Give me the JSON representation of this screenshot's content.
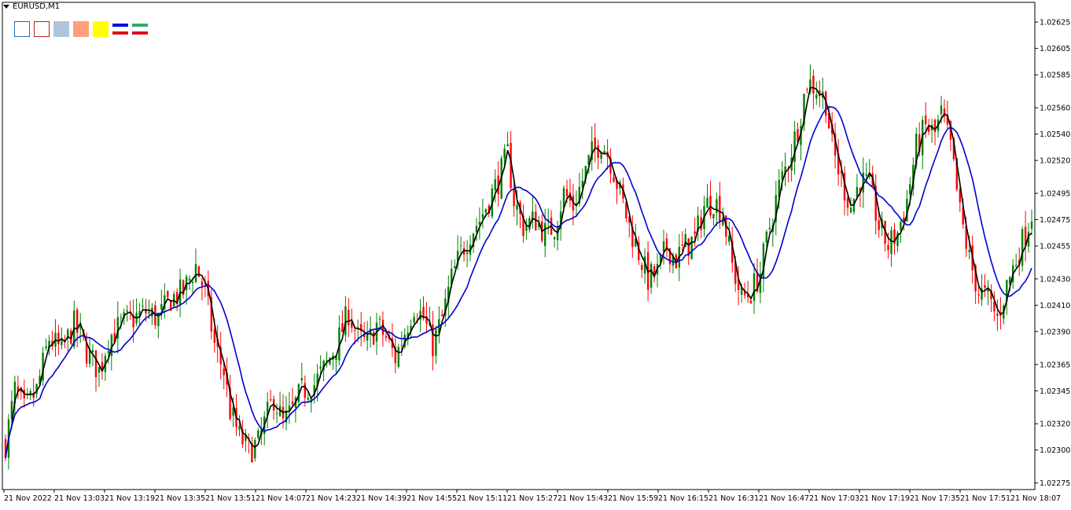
{
  "header": {
    "symbol_label": "EURUSD,M1"
  },
  "toolbar": {
    "buttons": [
      {
        "name": "bull-candle-outline-swatch",
        "fill": "#ffffff",
        "border": "#2d6fb3"
      },
      {
        "name": "bear-candle-outline-swatch",
        "fill": "#ffffff",
        "border": "#b22222"
      },
      {
        "name": "bull-body-color-swatch",
        "fill": "#b0c4de",
        "border": "#b0c4de"
      },
      {
        "name": "bear-body-color-swatch",
        "fill": "#ffa07a",
        "border": "#ffa07a"
      },
      {
        "name": "highlight-color-swatch",
        "fill": "#ffff00",
        "border": "#ffff00"
      },
      {
        "name": "line-style-button-1",
        "top": "#0000e0",
        "bottom": "#e01020"
      },
      {
        "name": "line-style-button-2",
        "top": "#33aa66",
        "bottom": "#e01020"
      }
    ]
  },
  "colors": {
    "bull": "#008000",
    "bear": "#ff0000",
    "ma_fast": "#000000",
    "ma_slow": "#0000cc",
    "axis": "#000000"
  },
  "chart_data": {
    "type": "candlestick",
    "symbol": "EURUSD",
    "timeframe": "M1",
    "ylim": [
      1.0227,
      1.0264
    ],
    "y_ticks": [
      "1.02625",
      "1.02605",
      "1.02585",
      "1.02560",
      "1.02540",
      "1.02520",
      "1.02495",
      "1.02475",
      "1.02455",
      "1.02430",
      "1.02410",
      "1.02390",
      "1.02365",
      "1.02345",
      "1.02320",
      "1.02300",
      "1.02275"
    ],
    "x_ticks": [
      "21 Nov 2022",
      "21 Nov 13:03",
      "21 Nov 13:19",
      "21 Nov 13:35",
      "21 Nov 13:51",
      "21 Nov 14:07",
      "21 Nov 14:23",
      "21 Nov 14:39",
      "21 Nov 14:55",
      "21 Nov 15:11",
      "21 Nov 15:27",
      "21 Nov 15:43",
      "21 Nov 15:59",
      "21 Nov 16:15",
      "21 Nov 16:31",
      "21 Nov 16:47",
      "21 Nov 17:03",
      "21 Nov 17:19",
      "21 Nov 17:35",
      "21 Nov 17:51",
      "21 Nov 18:07"
    ],
    "candle_count": 330,
    "close_path": [
      [
        0,
        1.02305
      ],
      [
        3,
        1.02345
      ],
      [
        6,
        1.0233
      ],
      [
        10,
        1.02345
      ],
      [
        14,
        1.02385
      ],
      [
        18,
        1.02375
      ],
      [
        22,
        1.02395
      ],
      [
        26,
        1.02375
      ],
      [
        30,
        1.0236
      ],
      [
        33,
        1.02385
      ],
      [
        37,
        1.02395
      ],
      [
        41,
        1.024
      ],
      [
        45,
        1.02405
      ],
      [
        49,
        1.024
      ],
      [
        53,
        1.02415
      ],
      [
        57,
        1.0242
      ],
      [
        61,
        1.0244
      ],
      [
        64,
        1.0242
      ],
      [
        67,
        1.0238
      ],
      [
        70,
        1.0236
      ],
      [
        72,
        1.0233
      ],
      [
        75,
        1.0231
      ],
      [
        78,
        1.023
      ],
      [
        81,
        1.02305
      ],
      [
        83,
        1.0232
      ],
      [
        86,
        1.0234
      ],
      [
        89,
        1.0232
      ],
      [
        92,
        1.0233
      ],
      [
        95,
        1.02345
      ],
      [
        99,
        1.0235
      ],
      [
        103,
        1.02365
      ],
      [
        107,
        1.02385
      ],
      [
        110,
        1.02405
      ],
      [
        113,
        1.02385
      ],
      [
        116,
        1.0238
      ],
      [
        119,
        1.02395
      ],
      [
        122,
        1.02385
      ],
      [
        125,
        1.0237
      ],
      [
        128,
        1.0239
      ],
      [
        131,
        1.0241
      ],
      [
        134,
        1.024
      ],
      [
        137,
        1.0238
      ],
      [
        140,
        1.024
      ],
      [
        143,
        1.0243
      ],
      [
        146,
        1.0245
      ],
      [
        149,
        1.02465
      ],
      [
        152,
        1.02475
      ],
      [
        155,
        1.0249
      ],
      [
        158,
        1.02505
      ],
      [
        161,
        1.02525
      ],
      [
        163,
        1.0249
      ],
      [
        166,
        1.0247
      ],
      [
        170,
        1.02475
      ],
      [
        173,
        1.02465
      ],
      [
        176,
        1.0247
      ],
      [
        179,
        1.02495
      ],
      [
        182,
        1.02485
      ],
      [
        185,
        1.02505
      ],
      [
        188,
        1.02525
      ],
      [
        191,
        1.02535
      ],
      [
        194,
        1.0252
      ],
      [
        197,
        1.02495
      ],
      [
        200,
        1.0247
      ],
      [
        203,
        1.0245
      ],
      [
        206,
        1.0243
      ],
      [
        209,
        1.02435
      ],
      [
        212,
        1.02455
      ],
      [
        215,
        1.02445
      ],
      [
        218,
        1.02455
      ],
      [
        221,
        1.0246
      ],
      [
        224,
        1.02485
      ],
      [
        227,
        1.0249
      ],
      [
        230,
        1.0248
      ],
      [
        233,
        1.0244
      ],
      [
        236,
        1.02415
      ],
      [
        239,
        1.0242
      ],
      [
        242,
        1.02435
      ],
      [
        245,
        1.0247
      ],
      [
        248,
        1.025
      ],
      [
        251,
        1.0252
      ],
      [
        254,
        1.02545
      ],
      [
        257,
        1.0258
      ],
      [
        260,
        1.02575
      ],
      [
        263,
        1.02565
      ],
      [
        265,
        1.0253
      ],
      [
        268,
        1.02505
      ],
      [
        271,
        1.02485
      ],
      [
        274,
        1.02505
      ],
      [
        277,
        1.025
      ],
      [
        280,
        1.0247
      ],
      [
        283,
        1.02455
      ],
      [
        286,
        1.02465
      ],
      [
        289,
        1.0249
      ],
      [
        292,
        1.0253
      ],
      [
        295,
        1.02545
      ],
      [
        298,
        1.0254
      ],
      [
        300,
        1.02555
      ],
      [
        303,
        1.0253
      ],
      [
        306,
        1.0248
      ],
      [
        309,
        1.02445
      ],
      [
        312,
        1.0242
      ],
      [
        315,
        1.02415
      ],
      [
        318,
        1.024
      ],
      [
        321,
        1.02425
      ],
      [
        324,
        1.02445
      ],
      [
        327,
        1.02465
      ],
      [
        329,
        1.0248
      ]
    ],
    "series": [
      {
        "name": "",
        "type": "moving-average",
        "color": "#000000",
        "period": 3
      },
      {
        "name": "",
        "type": "moving-average",
        "color": "#0000cc",
        "period": 12
      }
    ]
  }
}
